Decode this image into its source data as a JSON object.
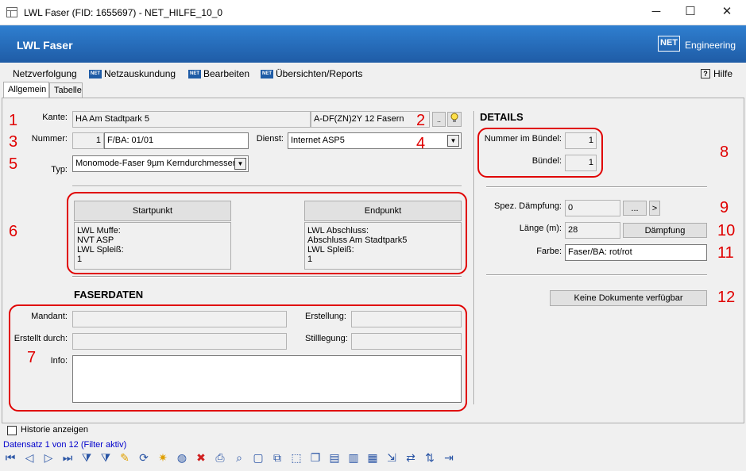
{
  "window": {
    "title": "LWL Faser (FID: 1655697) - NET_HILFE_10_0",
    "minimize": "─",
    "maximize": "☐",
    "close": "✕"
  },
  "banner": {
    "app_title": "LWL Faser",
    "logo_text": "NET",
    "brand": "Engineering"
  },
  "menu": {
    "items": [
      "Netzverfolgung",
      "Netzauskundung",
      "Bearbeiten",
      "Übersichten/Reports"
    ],
    "net_badge": "NET",
    "help": "Hilfe",
    "help_icon": "?"
  },
  "tabs": [
    "Allgemein",
    "Tabelle"
  ],
  "form": {
    "kante_label": "Kante:",
    "kante_value": "HA Am Stadtpark 5",
    "kante_type": "A-DF(ZN)2Y 12 Fasern",
    "browse": "..",
    "nummer_label": "Nummer:",
    "nummer_value": "1",
    "nummer_ba": "F/BA: 01/01",
    "dienst_label": "Dienst:",
    "dienst_value": "Internet ASP5",
    "typ_label": "Typ:",
    "typ_value": "Monomode-Faser 9µm Kerndurchmesser",
    "startpunkt_btn": "Startpunkt",
    "startpunkt_text": "LWL Muffe:\nNVT ASP\nLWL Spleiß:\n1",
    "endpunkt_btn": "Endpunkt",
    "endpunkt_text": "LWL Abschluss:\nAbschluss Am Stadtpark5\nLWL Spleiß:\n1"
  },
  "faserdaten": {
    "title": "FASERDATEN",
    "mandant_label": "Mandant:",
    "mandant_value": "",
    "erstellung_label": "Erstellung:",
    "erstellung_value": "",
    "erstellt_label": "Erstellt durch:",
    "erstellt_value": "",
    "stilllegung_label": "Stilllegung:",
    "stilllegung_value": "",
    "info_label": "Info:",
    "info_value": ""
  },
  "details": {
    "title": "DETAILS",
    "nr_buendel_label": "Nummer im Bündel:",
    "nr_buendel_value": "1",
    "buendel_label": "Bündel:",
    "buendel_value": "1",
    "spez_label": "Spez. Dämpfung:",
    "spez_value": "0",
    "spez_browse": "...",
    "spez_next": ">",
    "laenge_label": "Länge (m):",
    "laenge_value": "28",
    "daempfung_btn": "Dämpfung",
    "farbe_label": "Farbe:",
    "farbe_value": "Faser/BA: rot/rot",
    "dokumente_btn": "Keine Dokumente verfügbar"
  },
  "markers": [
    "1",
    "2",
    "3",
    "4",
    "5",
    "6",
    "7",
    "8",
    "9",
    "10",
    "11",
    "12"
  ],
  "status": {
    "historie": "Historie anzeigen",
    "datensatz": "Datensatz 1 von 12 (Filter aktiv)"
  },
  "colors": {
    "accent": "#1f5ca6",
    "annotation_red": "#e00000",
    "link_blue": "#0000cc"
  },
  "toolbar_icons": [
    "first-icon",
    "prev-icon",
    "next-icon",
    "last-icon",
    "filter-add-icon",
    "filter-remove-icon",
    "edit-icon",
    "refresh-icon",
    "new-icon",
    "globe-icon",
    "delete-icon",
    "print-icon",
    "zoom-icon",
    "select-icon",
    "multi-select-icon",
    "area-select-icon",
    "copy-icon",
    "new-doc-icon",
    "document-icon",
    "report-icon",
    "export-icon",
    "network-icon",
    "sort-icon",
    "exit-icon"
  ]
}
